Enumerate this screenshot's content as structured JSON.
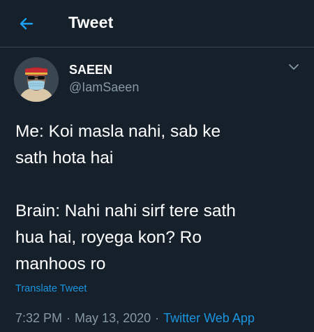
{
  "header": {
    "title": "Tweet",
    "back_icon": "arrow-left-icon",
    "accent_color": "#1da1f2",
    "background": "#15202b"
  },
  "author": {
    "display_name": "SAEEN",
    "handle": "@IamSaeen",
    "avatar_icon": "avatar-image",
    "menu_icon": "chevron-down-icon"
  },
  "tweet": {
    "lines_1": [
      "Me: Koi masla nahi, sab ke",
      "sath hota hai"
    ],
    "lines_2": [
      "Brain: Nahi nahi sirf tere sath",
      "hua hai, royega kon? Ro",
      "manhoos ro"
    ],
    "translate_label": "Translate Tweet"
  },
  "meta": {
    "time": "7:32 PM",
    "date": "May 13, 2020",
    "separator": "·",
    "source": "Twitter Web App"
  }
}
